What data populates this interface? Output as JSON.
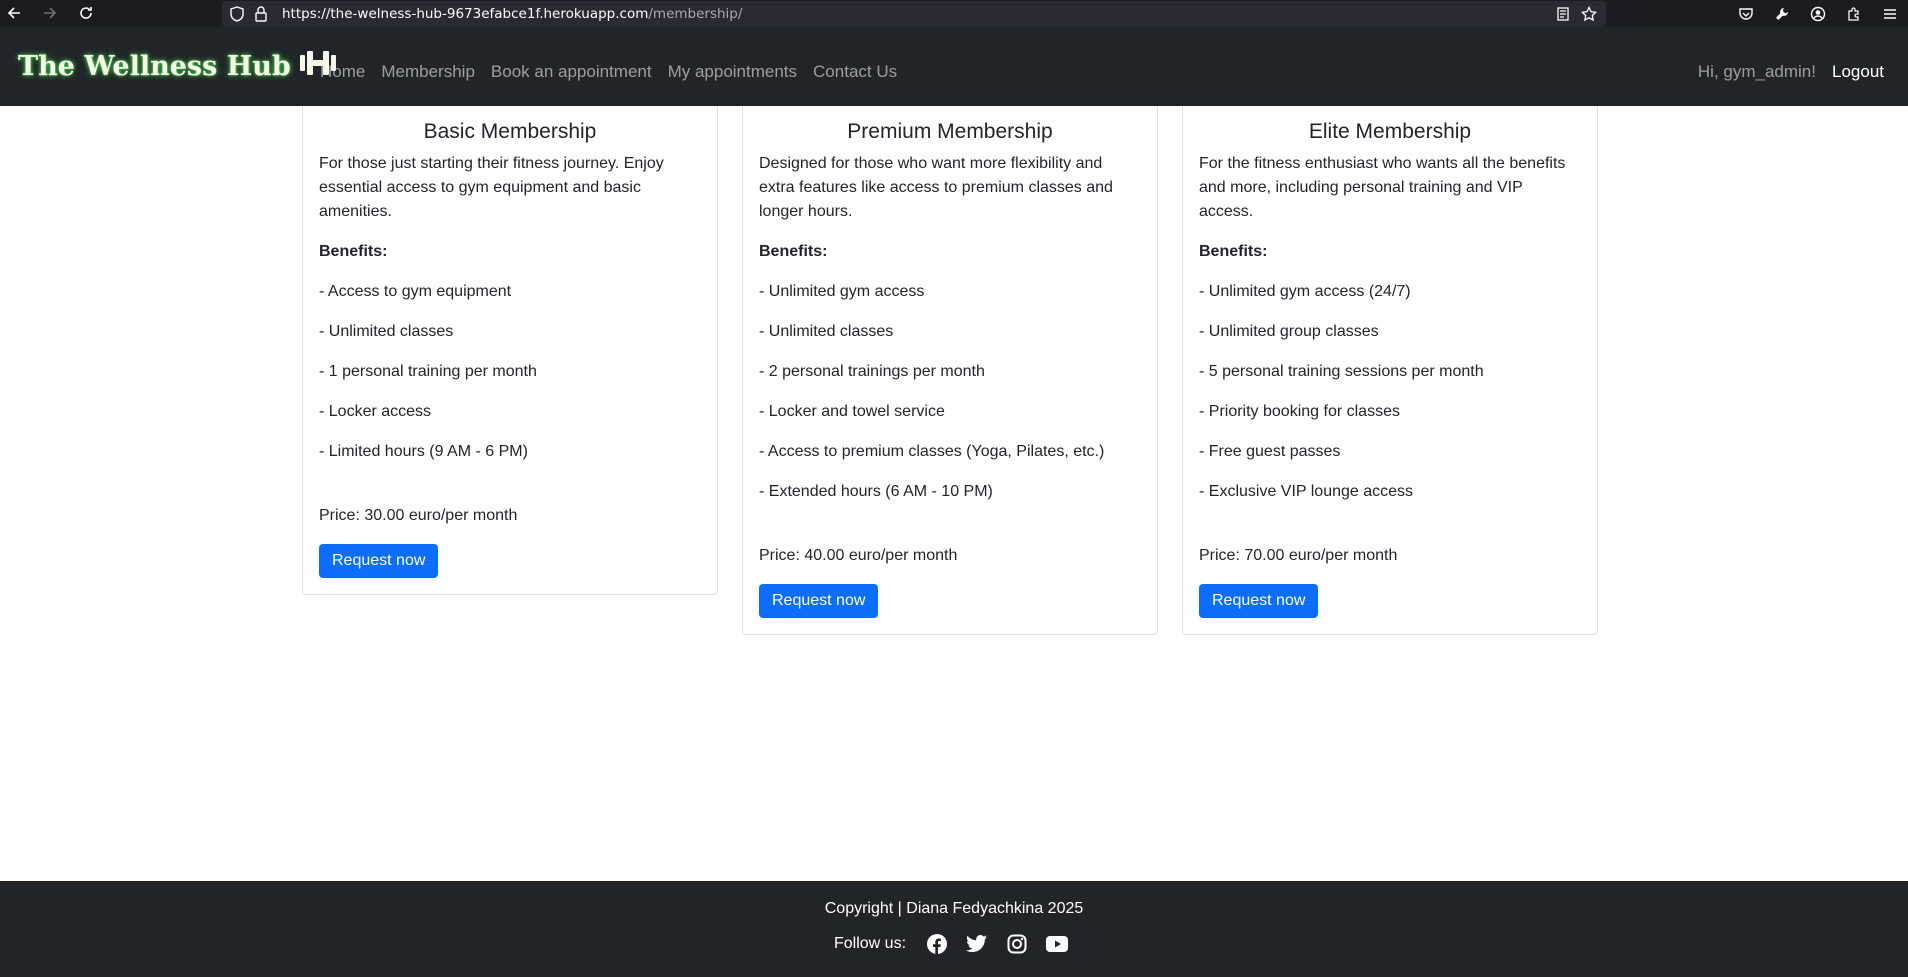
{
  "browser": {
    "url_host": "https://the-welness-hub-9673efabce1f.herokuapp.com",
    "url_path": "/membership/"
  },
  "navbar": {
    "brand": "The Wellness Hub",
    "links": [
      "Home",
      "Membership",
      "Book an appointment",
      "My appointments",
      "Contact Us"
    ],
    "greeting": "Hi, gym_admin!",
    "logout": "Logout"
  },
  "cards": [
    {
      "title": "Basic Membership",
      "description": "For those just starting their fitness journey. Enjoy essential access to gym equipment and basic amenities.",
      "benefits_label": "Benefits:",
      "benefits": [
        "- Access to gym equipment",
        "- Unlimited classes",
        "- 1 personal training per month",
        "- Locker access",
        "- Limited hours (9 AM - 6 PM)"
      ],
      "price": "Price: 30.00 euro/per month",
      "button": "Request now"
    },
    {
      "title": "Premium Membership",
      "description": "Designed for those who want more flexibility and extra features like access to premium classes and longer hours.",
      "benefits_label": "Benefits:",
      "benefits": [
        "- Unlimited gym access",
        "- Unlimited classes",
        "- 2 personal trainings per month",
        "- Locker and towel service",
        "- Access to premium classes (Yoga, Pilates, etc.)",
        "- Extended hours (6 AM - 10 PM)"
      ],
      "price": "Price: 40.00 euro/per month",
      "button": "Request now"
    },
    {
      "title": "Elite Membership",
      "description": "For the fitness enthusiast who wants all the benefits and more, including personal training and VIP access.",
      "benefits_label": "Benefits:",
      "benefits": [
        "- Unlimited gym access (24/7)",
        "- Unlimited group classes",
        "- 5 personal training sessions per month",
        "- Priority booking for classes",
        "- Free guest passes",
        "- Exclusive VIP lounge access"
      ],
      "price": "Price: 70.00 euro/per month",
      "button": "Request now"
    }
  ],
  "footer": {
    "copyright": "Copyright | Diana Fedyachkina 2025",
    "follow_label": "Follow us:",
    "social_icons": [
      "facebook-icon",
      "twitter-icon",
      "instagram-icon",
      "youtube-icon"
    ]
  },
  "colors": {
    "navbar_bg": "#212529",
    "button_primary": "#0d6efd",
    "brand_glow": "#50dc50"
  }
}
